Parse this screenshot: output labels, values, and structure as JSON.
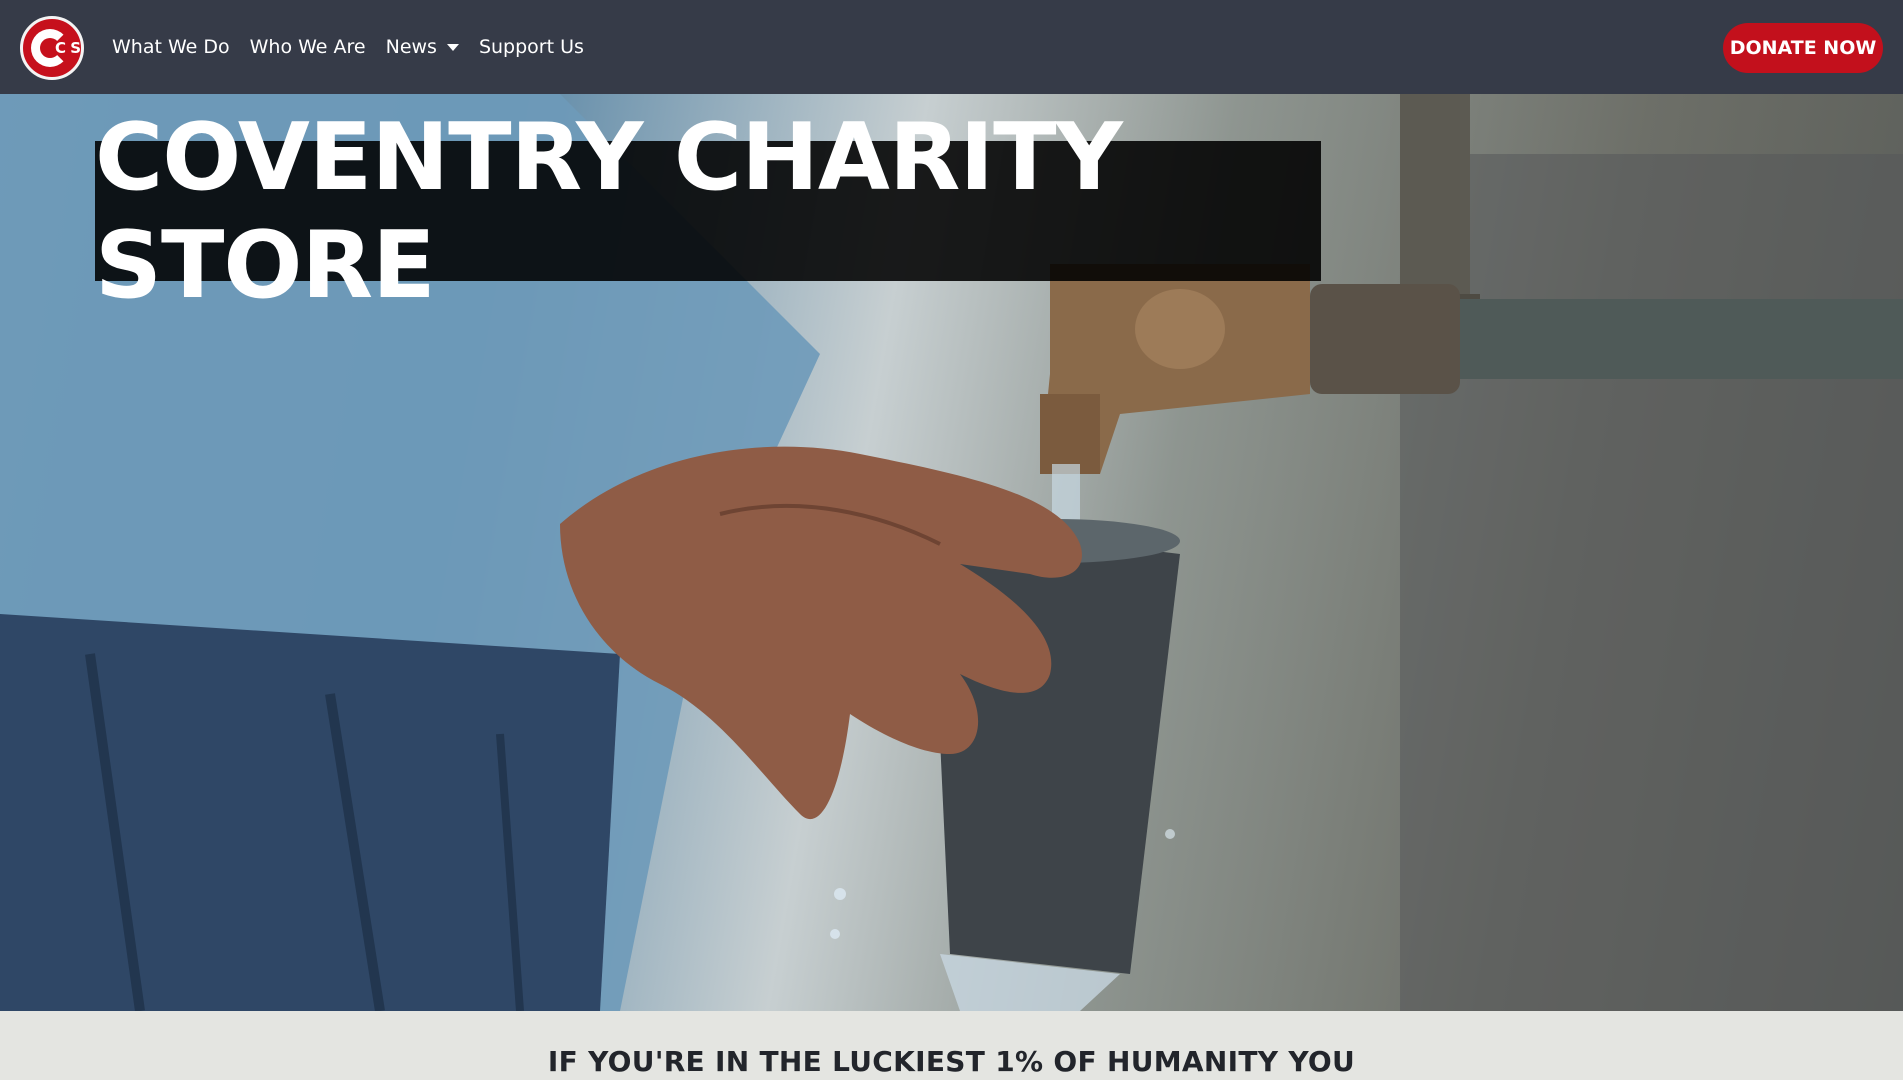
{
  "brand": {
    "logo_text": "CS",
    "logo_color": "#c6101c"
  },
  "nav": {
    "items": [
      {
        "label": "What We Do"
      },
      {
        "label": "Who We Are"
      },
      {
        "label": "News",
        "dropdown": true
      },
      {
        "label": "Support Us"
      }
    ],
    "donate_label": "DONATE NOW"
  },
  "hero": {
    "title": "COVENTRY CHARITY STORE",
    "image_description_icon": "water-tap-photo"
  },
  "band": {
    "heading": "IF YOU'RE IN THE LUCKIEST 1% OF HUMANITY YOU"
  },
  "colors": {
    "navbar": "#363b48",
    "accent": "#c3101c",
    "band": "#e4e5e1"
  }
}
